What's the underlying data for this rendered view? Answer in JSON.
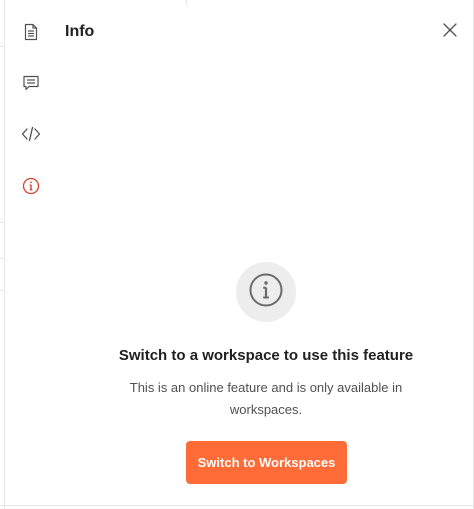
{
  "rail": {
    "items": [
      {
        "icon": "document-icon",
        "active": false
      },
      {
        "icon": "comment-icon",
        "active": false
      },
      {
        "icon": "code-icon",
        "active": false
      },
      {
        "icon": "info-icon",
        "active": true
      }
    ]
  },
  "header": {
    "title": "Info",
    "close_icon": "close-icon"
  },
  "empty_state": {
    "icon": "info-icon",
    "title": "Switch to a workspace to use this feature",
    "description": "This is an online feature and is only available in workspaces.",
    "button_label": "Switch to Workspaces"
  },
  "colors": {
    "accent": "#ff6c37",
    "active_icon": "#d9412e",
    "icon": "#505050",
    "empty_icon_bg": "#ededed",
    "empty_icon_fg": "#6b6b6b"
  }
}
